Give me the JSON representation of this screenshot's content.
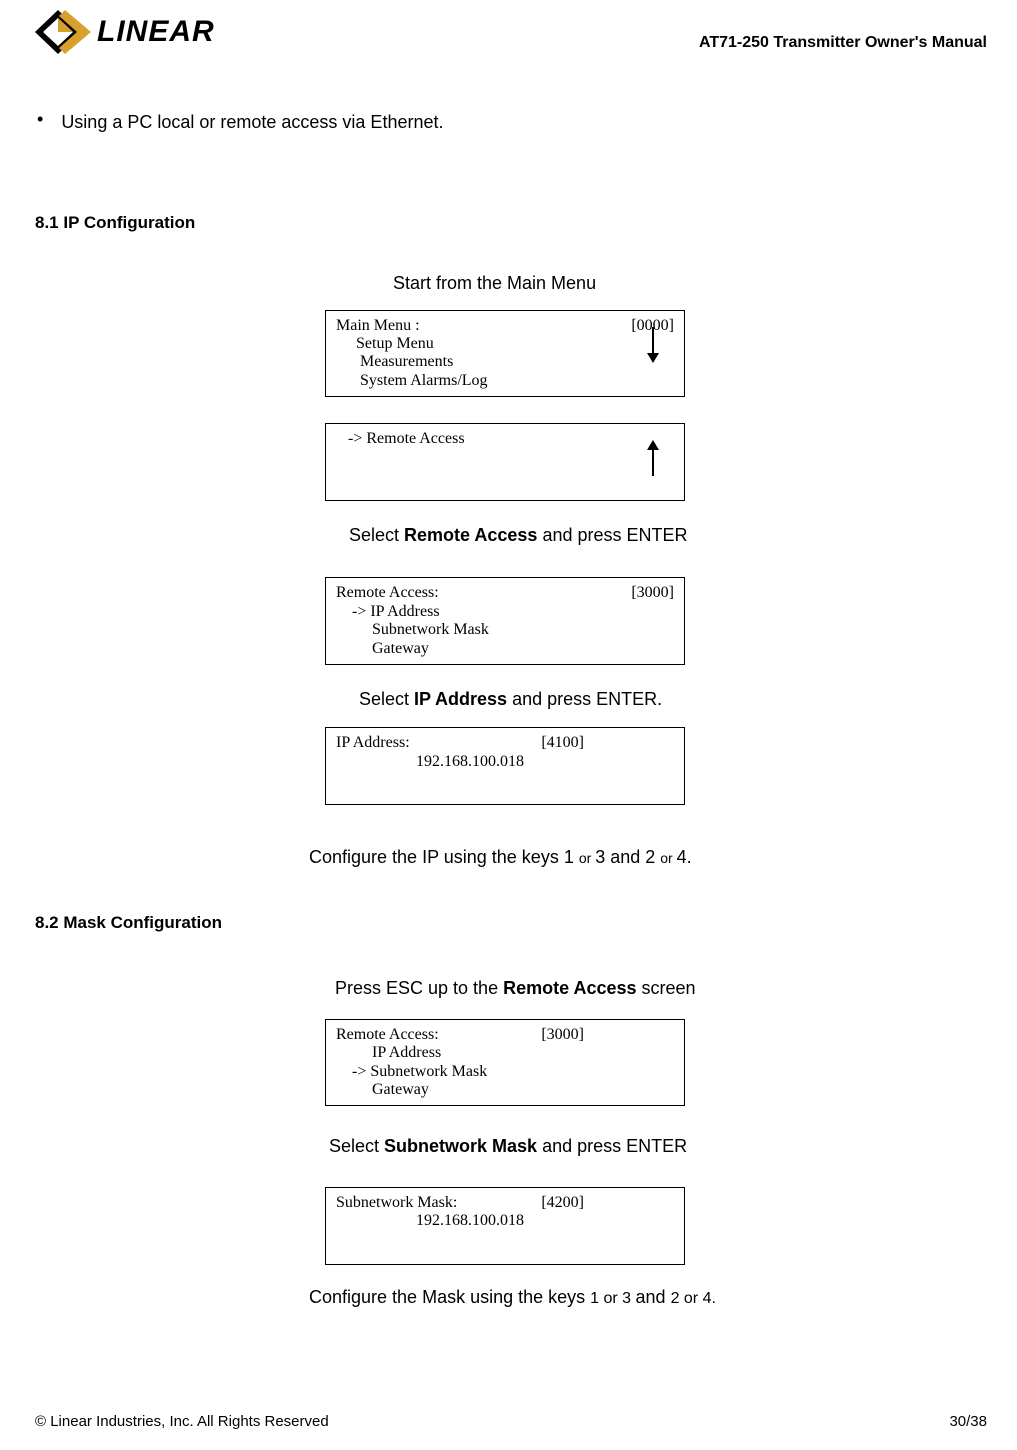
{
  "header": {
    "brand": "LINEAR",
    "doc_title": "AT71-250 Transmitter Owner's Manual"
  },
  "bullet": "Using a PC local or remote access via Ethernet.",
  "section_8_1": {
    "heading": "8.1 IP Configuration",
    "step1": "Start from the Main Menu",
    "lcd1": {
      "title": "Main Menu :",
      "code": "[0000]",
      "rows": [
        "     Setup Menu",
        "      Measurements",
        "      System Alarms/Log"
      ]
    },
    "lcd2": {
      "title": "   -> Remote Access",
      "code": "",
      "rows": []
    },
    "step2_pre": "Select ",
    "step2_bold": "Remote Access",
    "step2_post": " and press ENTER",
    "lcd3": {
      "title": "Remote Access:",
      "code": "[3000]",
      "rows": [
        "    -> IP Address",
        "         Subnetwork Mask",
        "         Gateway"
      ]
    },
    "step3_pre": "Select ",
    "step3_bold": "IP Address",
    "step3_post": " and press ENTER.",
    "lcd4": {
      "title": "IP Address:",
      "code": "[4100]",
      "rows": [
        "                    192.168.100.018"
      ]
    },
    "step4": {
      "p1": "Configure the IP using the keys 1 ",
      "s1": "or ",
      "p2": "3 and  2 ",
      "s2": "or ",
      "p3": "4."
    }
  },
  "section_8_2": {
    "heading": "8.2 Mask Configuration",
    "step1_pre": "Press ESC up to the ",
    "step1_bold": "Remote Access",
    "step1_post": " screen",
    "lcd5": {
      "title": "Remote Access:",
      "code": "[3000]",
      "rows": [
        "         IP Address",
        "    -> Subnetwork Mask",
        "         Gateway"
      ]
    },
    "step2_pre": "Select ",
    "step2_bold": "Subnetwork Mask",
    "step2_post": " and press ENTER",
    "lcd6": {
      "title": "Subnetwork Mask:",
      "code": "[4200]",
      "rows": [
        "                    192.168.100.018"
      ]
    },
    "step3": {
      "p1": "Configure the Mask using the keys ",
      "s1": "1 or 3 ",
      "p2": "and ",
      "s2": "2 or 4."
    }
  },
  "footer": {
    "left": "© Linear Industries, Inc. All Rights Reserved",
    "right": "30/38"
  }
}
